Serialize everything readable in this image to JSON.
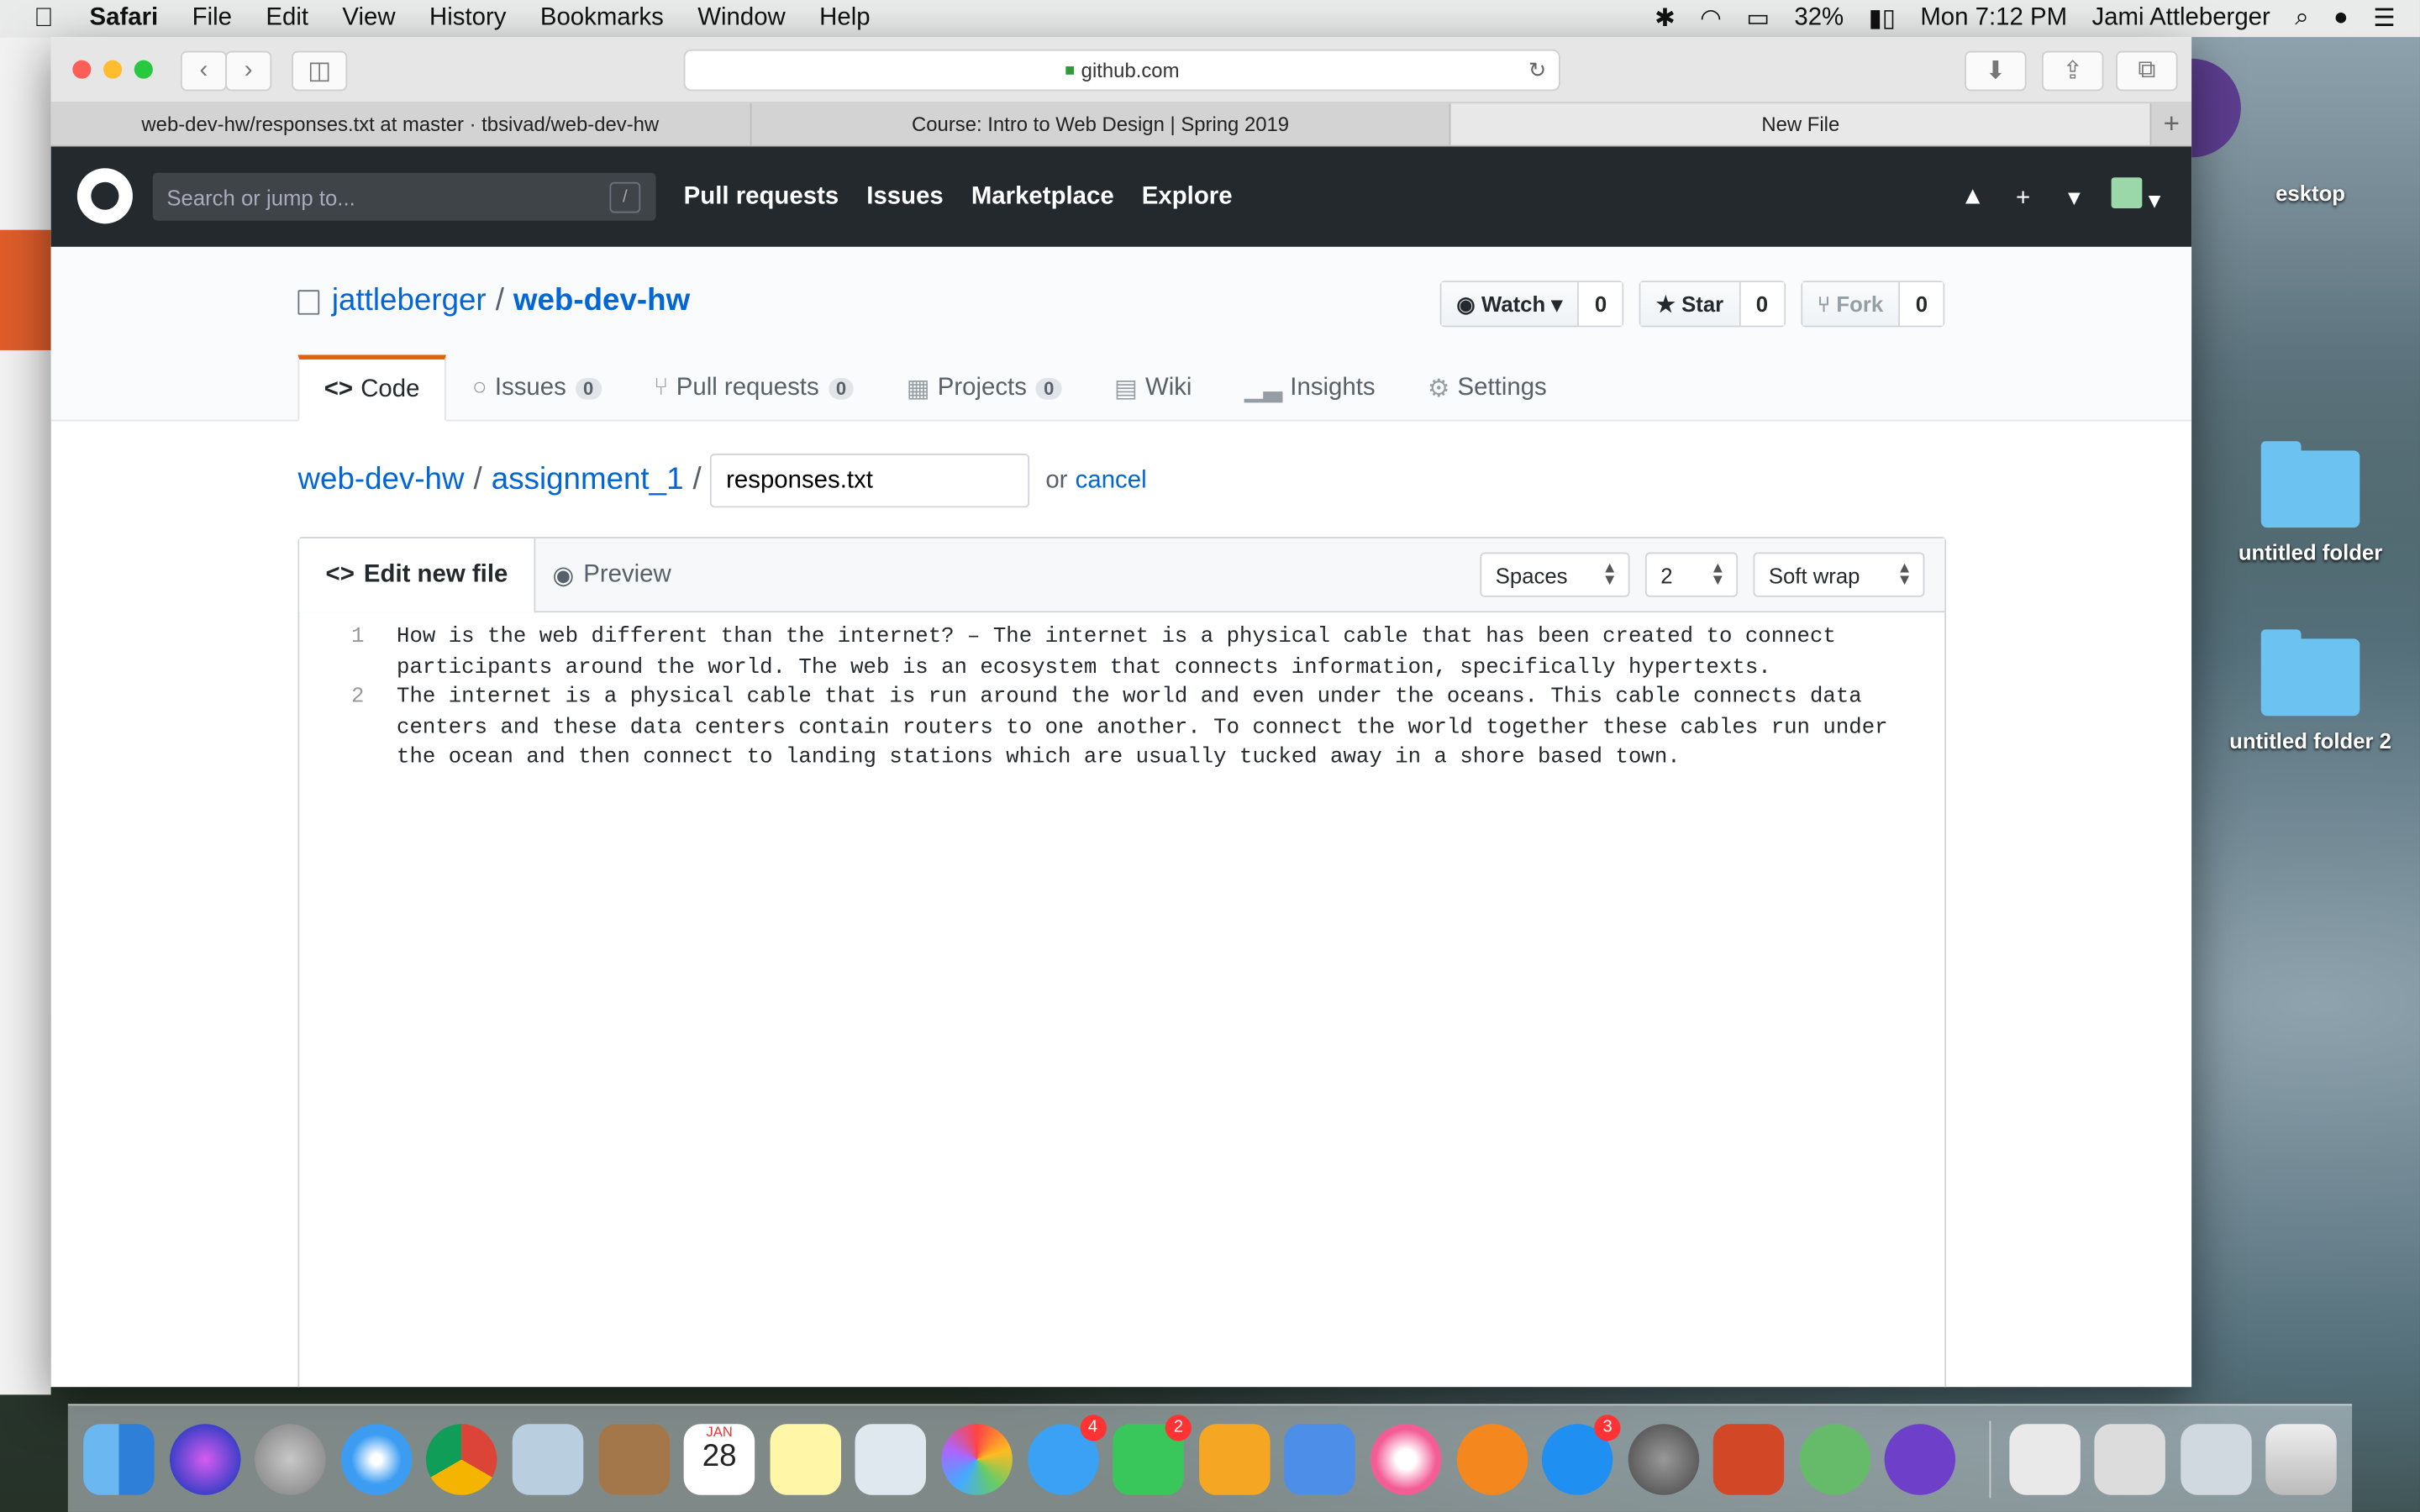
{
  "menubar": {
    "app": "Safari",
    "items": [
      "File",
      "Edit",
      "View",
      "History",
      "Bookmarks",
      "Window",
      "Help"
    ],
    "battery": "32%",
    "clock": "Mon 7:12 PM",
    "user": "Jami Attleberger"
  },
  "browser": {
    "url": "github.com",
    "tabs": [
      "web-dev-hw/responses.txt at master · tbsivad/web-dev-hw",
      "Course: Intro to Web Design | Spring 2019",
      "New File"
    ],
    "new_tab": "+"
  },
  "github": {
    "search_placeholder": "Search or jump to...",
    "search_key": "/",
    "nav": [
      "Pull requests",
      "Issues",
      "Marketplace",
      "Explore"
    ],
    "plus": "+",
    "owner": "jattleberger",
    "repo": "web-dev-hw",
    "watch": {
      "label": "Watch",
      "count": "0"
    },
    "star": {
      "label": "Star",
      "count": "0"
    },
    "fork": {
      "label": "Fork",
      "count": "0"
    },
    "tabs": {
      "code": "Code",
      "issues": "Issues",
      "issues_count": "0",
      "pulls": "Pull requests",
      "pulls_count": "0",
      "projects": "Projects",
      "projects_count": "0",
      "wiki": "Wiki",
      "insights": "Insights",
      "settings": "Settings"
    }
  },
  "editor": {
    "crumb_repo": "web-dev-hw",
    "crumb_dir": "assignment_1",
    "filename": "responses.txt",
    "or": "or",
    "cancel": "cancel",
    "tab_edit": "Edit new file",
    "tab_preview": "Preview",
    "indent_mode": "Spaces",
    "indent_size": "2",
    "wrap_mode": "Soft wrap",
    "lines": [
      {
        "n": "1",
        "text": "How is the web different than the internet? – The internet is a physical cable that has been created to connect participants around the world. The web is an ecosystem that connects information, specifically hypertexts."
      },
      {
        "n": "2",
        "text": "The internet is a physical cable that is run around the world and even under the oceans. This cable connects data centers and these data centers contain routers to one another. To connect the world together these cables run under the ocean and then connect to landing stations which are usually tucked away in a shore based town."
      }
    ]
  },
  "desktop": {
    "folder1": "untitled folder",
    "folder2": "untitled folder 2",
    "partial_label": "esktop"
  },
  "dock": {
    "calendar_month": "JAN",
    "calendar_day": "28",
    "messages_badge": "4",
    "facetime_badge": "2",
    "appstore_badge": "3"
  }
}
